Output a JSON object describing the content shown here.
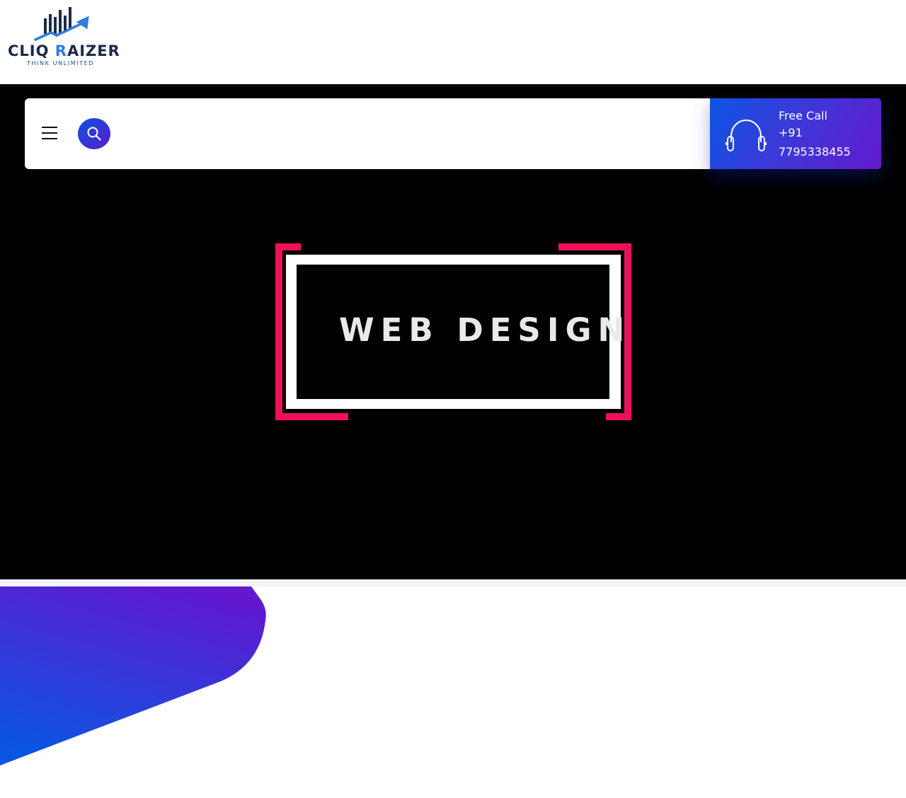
{
  "logo": {
    "name_part1": "CLIQ ",
    "name_accent": "R",
    "name_part2": "AIZER",
    "tagline": "THINK UNLIMITED",
    "icon": "bar-chart-arrow-icon"
  },
  "navbar": {
    "menu_icon": "hamburger-icon",
    "search_icon": "search-icon",
    "call": {
      "label": "Free Call",
      "number": "+91 7795338455",
      "icon": "headset-icon"
    }
  },
  "hero": {
    "banner_text": "WEB DESIGN"
  },
  "colors": {
    "brand_blue": "#0c55e4",
    "brand_purple": "#6419d0",
    "banner_pink": "#ee1158",
    "logo_navy": "#1b2a47",
    "logo_accent": "#2e7de0"
  }
}
